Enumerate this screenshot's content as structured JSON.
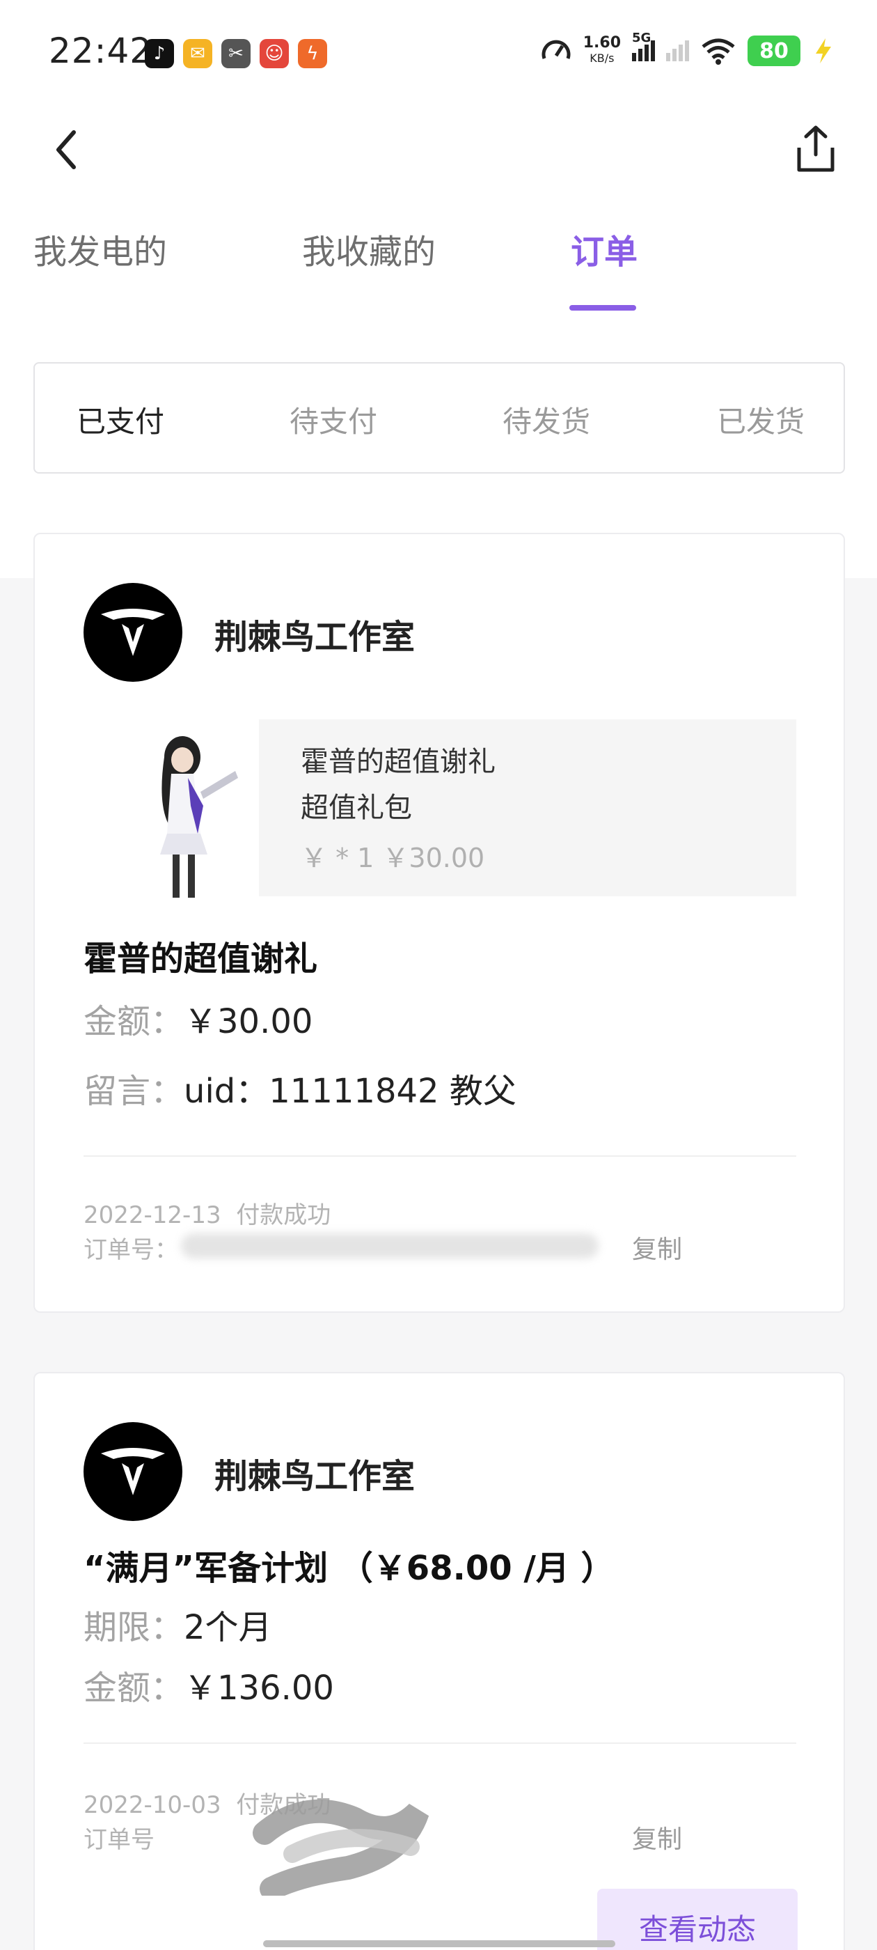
{
  "status_bar": {
    "time": "22:42",
    "net_speed": "1.60",
    "net_unit": "KB/s",
    "signal_label": "5G",
    "battery": "80",
    "app_icons": [
      "tiktok-icon",
      "mail-icon",
      "capcut-icon",
      "game-icon",
      "app-icon"
    ]
  },
  "tabs": [
    {
      "label": "我发电的"
    },
    {
      "label": "我收藏的"
    },
    {
      "label": "订单"
    }
  ],
  "subtabs": [
    {
      "label": "已支付"
    },
    {
      "label": "待支付"
    },
    {
      "label": "待发货"
    },
    {
      "label": "已发货"
    }
  ],
  "orders": [
    {
      "shop_name": "荆棘鸟工作室",
      "product_title": "霍普的超值谢礼",
      "product_sub": "超值礼包",
      "product_price": "￥ * 1  ￥30.00",
      "title": "霍普的超值谢礼",
      "amount_label": "金额：",
      "amount": "￥30.00",
      "note_label": "留言：",
      "note": "uid：11111842     教父",
      "date": "2022-12-13",
      "status": "付款成功",
      "order_no_label": "订单号：",
      "copy_label": "复制"
    },
    {
      "shop_name": "荆棘鸟工作室",
      "title": "“满月”军备计划 （￥68.00 /月 ）",
      "period_label": "期限：",
      "period": "2个月",
      "amount_label": "金额：",
      "amount": "￥136.00",
      "date": "2022-10-03",
      "status": "付款成功",
      "order_no_label": "订单号",
      "copy_label": "复制",
      "view_dynamic_label": "查看动态"
    }
  ],
  "colors": {
    "accent": "#8a5ee6",
    "accent_bg": "#efe6fd",
    "battery": "#3fcf4f"
  }
}
